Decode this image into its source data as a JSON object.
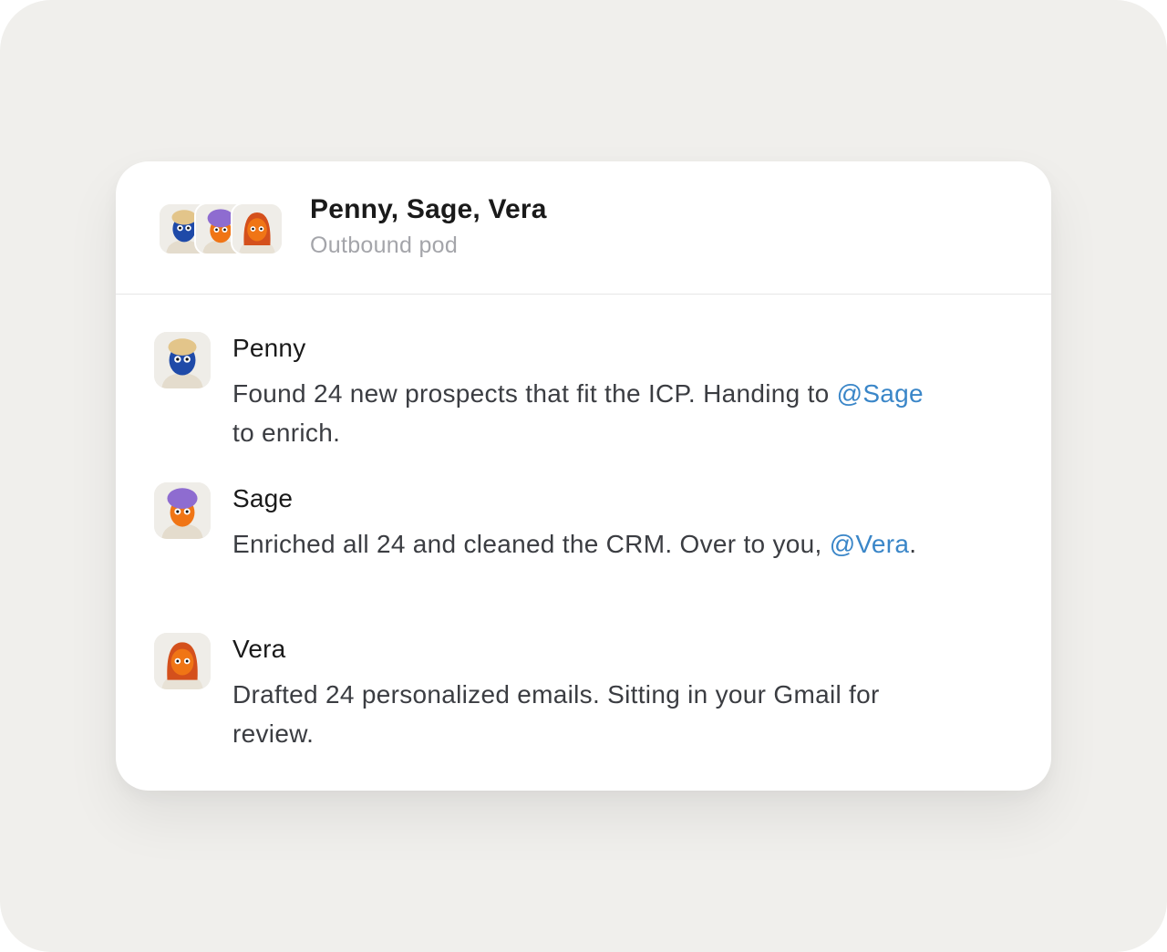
{
  "conversation": {
    "title": "Penny, Sage, Vera",
    "subtitle": "Outbound pod",
    "participants": [
      {
        "name": "Penny",
        "skin": "#1f4aa8",
        "hair": "#e3c58a"
      },
      {
        "name": "Sage",
        "skin": "#f07515",
        "hair": "#8e6cd0"
      },
      {
        "name": "Vera",
        "skin": "#f07515",
        "hair": "#d4501c"
      }
    ]
  },
  "messages": [
    {
      "author": "Penny",
      "text_before": "Found 24 new prospects that fit the ICP. Handing to ",
      "mention": "@Sage",
      "text_after": " to enrich."
    },
    {
      "author": "Sage",
      "text_before": "Enriched all 24 and cleaned the CRM. Over to you, ",
      "mention": "@Vera",
      "text_after": "."
    },
    {
      "author": "Vera",
      "text_before": "Drafted 24 personalized emails. Sitting in your Gmail for review.",
      "mention": "",
      "text_after": ""
    }
  ],
  "colors": {
    "background": "#f0efec",
    "card": "#ffffff",
    "mention": "#3a86c8",
    "muted": "#a4a5aa"
  }
}
